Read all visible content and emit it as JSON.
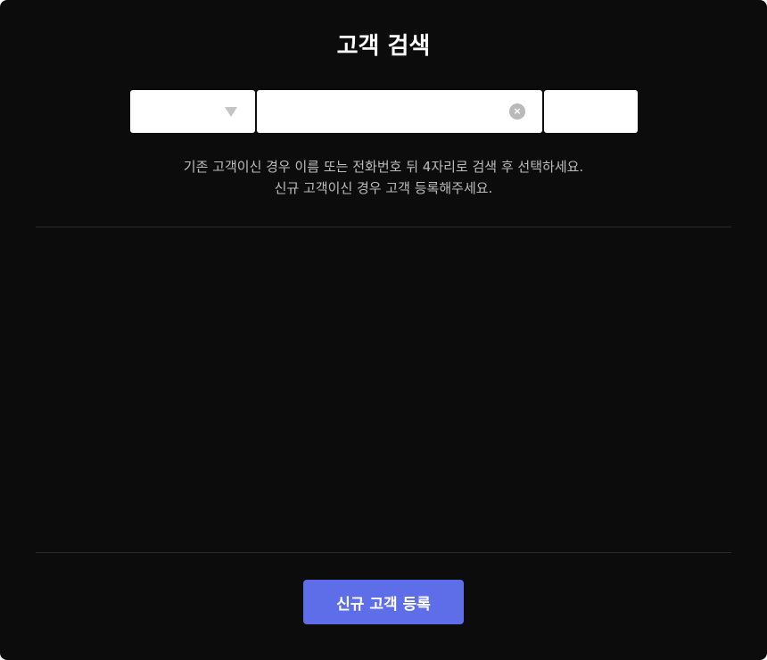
{
  "modal": {
    "title": "고객 검색"
  },
  "search": {
    "select": {
      "selected_value": "",
      "icon": "chevron-down-icon"
    },
    "input": {
      "value": "",
      "placeholder": ""
    },
    "clear_icon": "close-circle-icon",
    "clear_glyph": "×",
    "search_button_label": ""
  },
  "guide": {
    "line1": "기존 고객이신 경우 이름 또는 전화번호 뒤 4자리로 검색 후 선택하세요.",
    "line2": "신규 고객이신 경우 고객 등록해주세요."
  },
  "results": {
    "items": []
  },
  "footer": {
    "register_label": "신규 고객 등록"
  },
  "colors": {
    "background": "#0c0c0c",
    "primary_button": "#5e6ee9",
    "guide_text": "#bdbdbd",
    "divider": "#2b2b2b"
  }
}
